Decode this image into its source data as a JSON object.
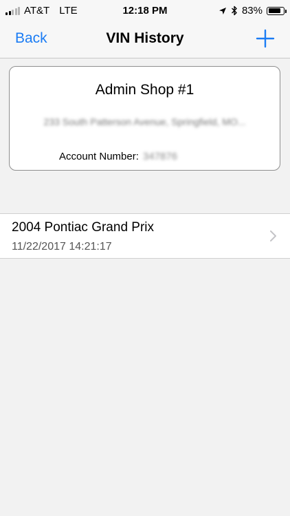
{
  "status_bar": {
    "carrier": "AT&T",
    "network": "LTE",
    "time": "12:18 PM",
    "battery_percent": "83%",
    "battery_level": 0.83,
    "signal_bars_active": 2,
    "signal_bars_total": 5,
    "icons": [
      "location-icon",
      "bluetooth-icon",
      "battery-icon"
    ]
  },
  "nav": {
    "back_label": "Back",
    "title": "VIN History",
    "add_icon": "plus-icon",
    "accent_color": "#1b7cf4"
  },
  "shop": {
    "name": "Admin Shop #1",
    "address": "233 South Patterson Avenue, Springfield, MO...",
    "account_label": "Account Number:",
    "account_number": "347876"
  },
  "vin_history": [
    {
      "vehicle": "2004 Pontiac Grand Prix",
      "timestamp": "11/22/2017 14:21:17"
    }
  ]
}
